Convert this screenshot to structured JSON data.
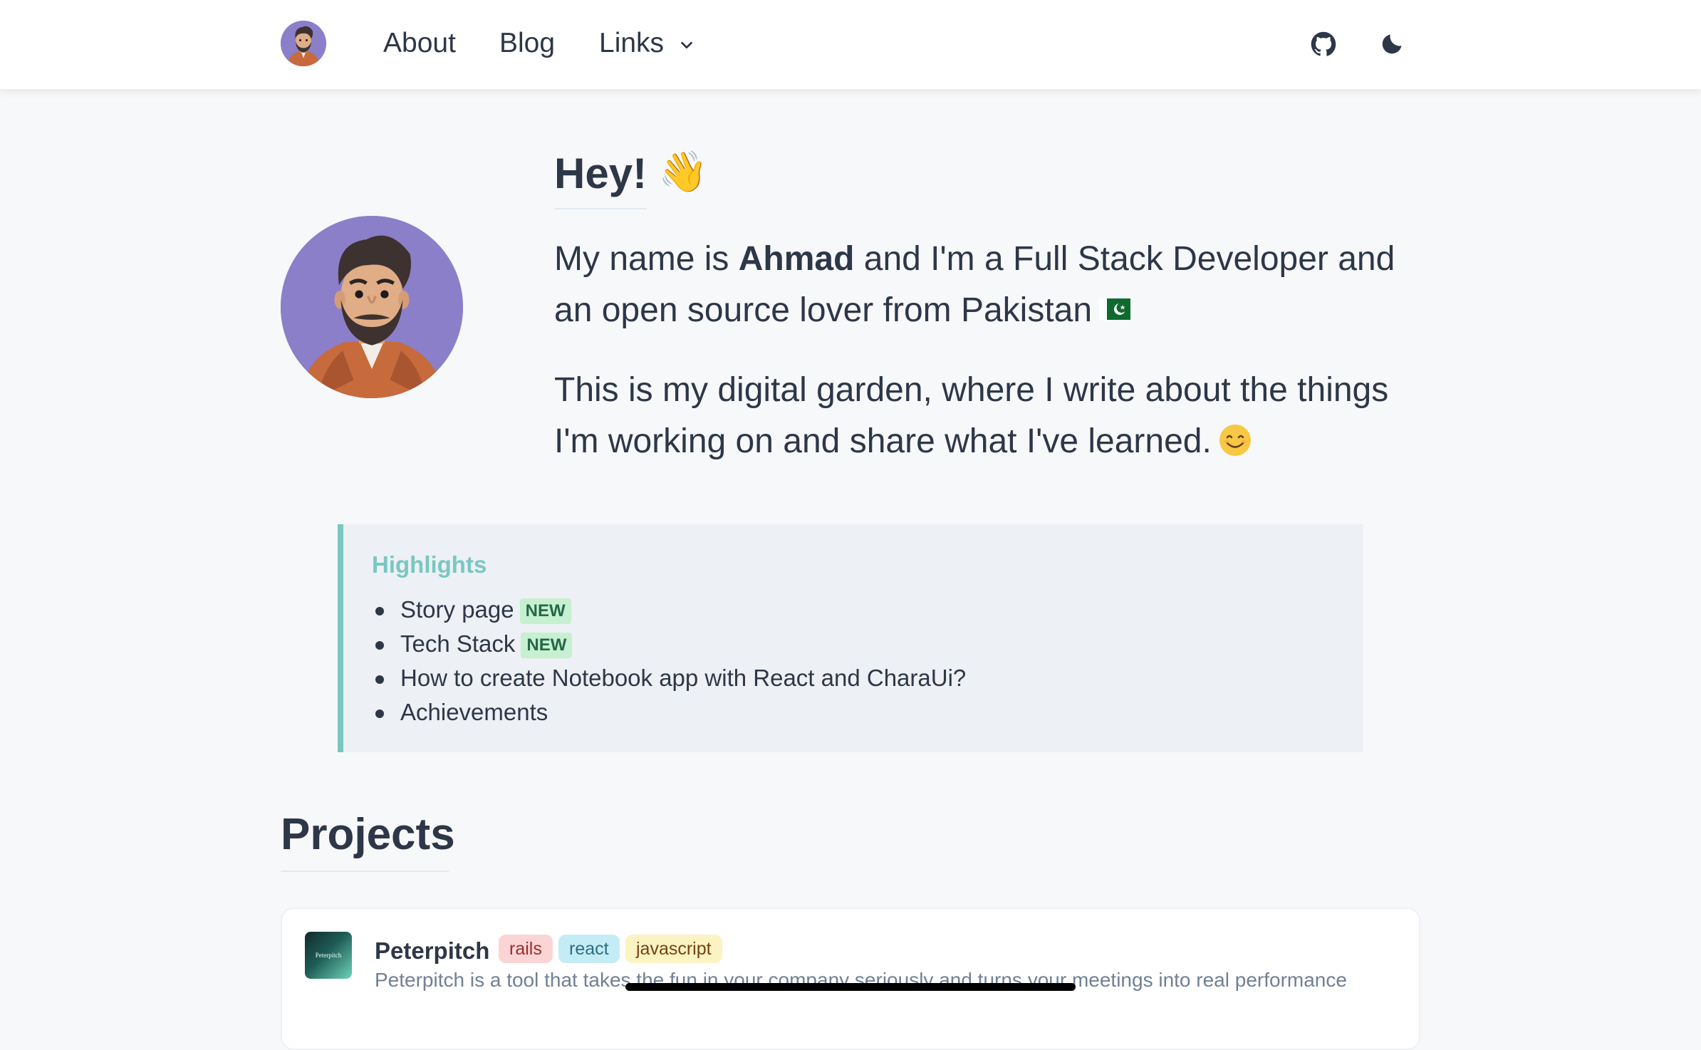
{
  "nav": {
    "about": "About",
    "blog": "Blog",
    "links": "Links"
  },
  "hero": {
    "title": "Hey!",
    "wave_emoji": "👋",
    "p1_prefix": "My name is ",
    "p1_name": "Ahmad",
    "p1_suffix": " and I'm a Full Stack Developer and an open source lover from Pakistan",
    "p2_text": "This is my digital garden, where I write about the things I'm working on and share what I've learned."
  },
  "highlights": {
    "title": "Highlights",
    "items": [
      {
        "label": "Story page",
        "badge": "NEW"
      },
      {
        "label": "Tech Stack",
        "badge": "NEW"
      },
      {
        "label": "How to create Notebook app with React and CharaUi?"
      },
      {
        "label": "Achievements"
      }
    ]
  },
  "projects": {
    "title": "Projects",
    "items": [
      {
        "name": "Peterpitch",
        "logo_text": "Peterpitch",
        "tags": [
          "rails",
          "react",
          "javascript"
        ],
        "description": "Peterpitch is a tool that takes the fun in your company seriously and turns your meetings into real performance"
      }
    ]
  },
  "icons": {
    "github": "github-icon",
    "theme": "moon-icon",
    "flag": "pakistan-flag-icon",
    "smile": "smile-emoji-icon"
  },
  "colors": {
    "accent": "#79c7c2",
    "avatar_bg": "#8c7fc9",
    "text": "#2d3748",
    "badge_new_bg": "#c6f0d0"
  }
}
